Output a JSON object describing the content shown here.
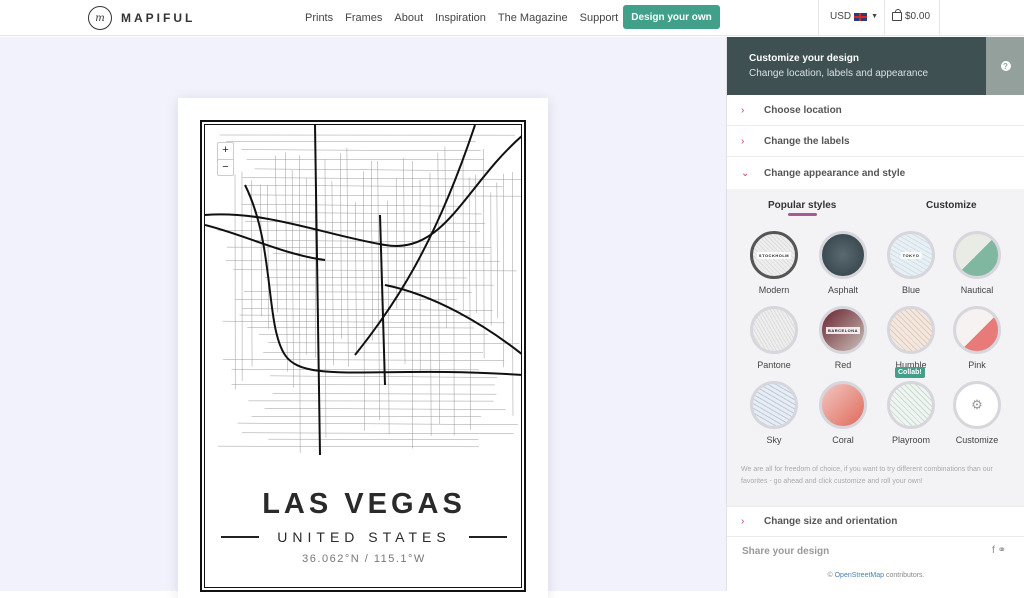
{
  "brand": {
    "name": "MAPIFUL",
    "mark": "m"
  },
  "nav": {
    "items": [
      "Prints",
      "Frames",
      "About",
      "Inspiration",
      "The Magazine",
      "Support"
    ],
    "cta": "Design your own"
  },
  "currency": {
    "label": "USD",
    "flag": "uk-flag-icon"
  },
  "cart": {
    "total": "$0.00",
    "icon": "shopping-bag-icon"
  },
  "map": {
    "zoom_in": "+",
    "zoom_out": "−",
    "city": "LAS VEGAS",
    "country": "UNITED STATES",
    "coords": "36.062°N / 115.1°W"
  },
  "panel": {
    "title": "Customize your design",
    "subtitle": "Change location, labels and appearance",
    "help": "?",
    "sections": {
      "location": "Choose location",
      "labels": "Change the labels",
      "appearance": "Change appearance and style",
      "size": "Change size and orientation"
    },
    "tabs": {
      "popular": "Popular styles",
      "customize": "Customize"
    },
    "styles": [
      {
        "name": "Modern",
        "tag": "STOCKHOLM"
      },
      {
        "name": "Asphalt",
        "tag": ""
      },
      {
        "name": "Blue",
        "tag": "TOKYO"
      },
      {
        "name": "Nautical",
        "tag": ""
      },
      {
        "name": "Pantone",
        "tag": ""
      },
      {
        "name": "Red",
        "tag": "BARCELONA"
      },
      {
        "name": "Humble",
        "tag": ""
      },
      {
        "name": "Pink",
        "tag": ""
      },
      {
        "name": "Sky",
        "tag": ""
      },
      {
        "name": "Coral",
        "tag": ""
      },
      {
        "name": "Playroom",
        "tag": "",
        "badge": "Collab!"
      },
      {
        "name": "Customize",
        "tag": ""
      }
    ],
    "selected_style": "Modern",
    "note": "We are all for freedom of choice, if you want to try different combinations than our favorites - go ahead and click customize and roll your own!",
    "share": "Share your design",
    "osm_prefix": "©",
    "osm_link": "OpenStreetMap",
    "osm_suffix": "contributors."
  },
  "colors": {
    "accent": "#40a08a",
    "header_bg": "#3e5052",
    "highlight": "#a45a94",
    "chevron": "#b4485e"
  }
}
